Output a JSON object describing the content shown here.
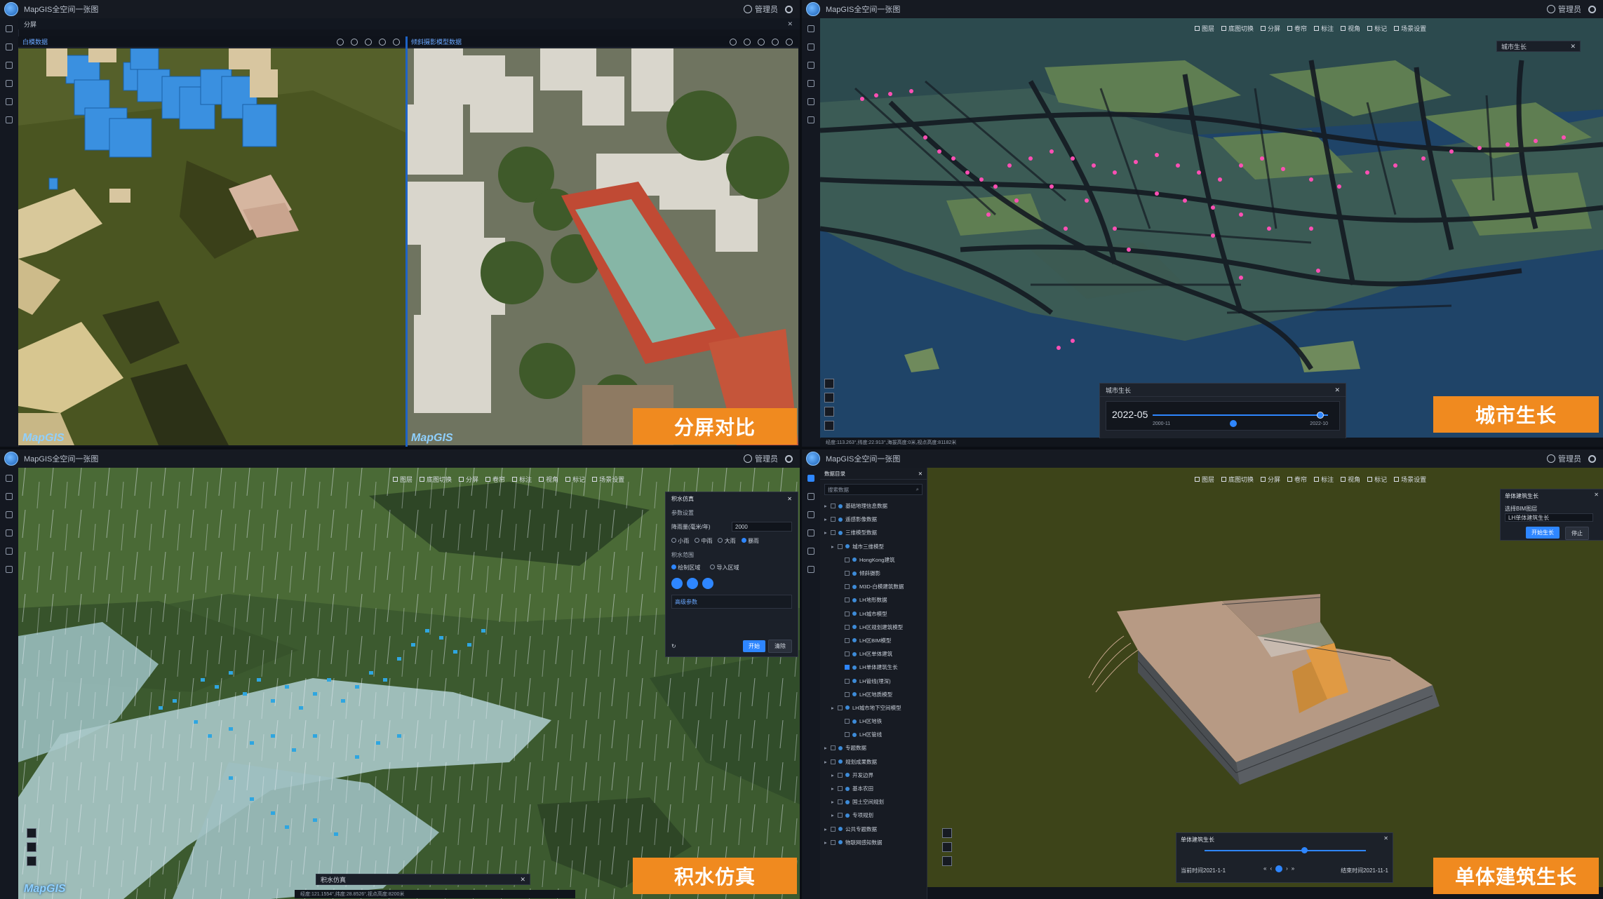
{
  "colors": {
    "accent": "#f08a1f",
    "blue": "#2e86ff",
    "pink": "#ff4fb4"
  },
  "q1": {
    "title": "MapGIS全空间一张图",
    "user": "管理员",
    "tab": "分屏",
    "left_panel_title": "白模数据",
    "right_panel_title": "倾斜摄影模型数据",
    "logo": "MapGIS",
    "tag": "分屏对比"
  },
  "q2": {
    "title": "MapGIS全空间一张图",
    "user": "管理员",
    "toolbar": [
      "图层",
      "底图切换",
      "分屏",
      "卷帘",
      "标注",
      "视角",
      "标记",
      "场景设置"
    ],
    "side_panel_title": "城市生长",
    "timeline": {
      "title": "城市生长",
      "current": "2022-05",
      "min": "2000-11",
      "max": "2022-10",
      "progress": 0.95
    },
    "status": "经度:113.263°,纬度:22.913°,海拔高度:0米,视点高度:81182米",
    "tag": "城市生长"
  },
  "q3": {
    "title": "MapGIS全空间一张图",
    "user": "管理员",
    "toolbar": [
      "图层",
      "底图切换",
      "分屏",
      "卷帘",
      "标注",
      "视角",
      "标记",
      "场景设置"
    ],
    "panel": {
      "title": "积水仿真",
      "section1": "参数设置",
      "param_label": "降雨量(毫米/年)",
      "param_value": "2000",
      "levels": [
        "小雨",
        "中雨",
        "大雨",
        "暴雨"
      ],
      "section2": "积水范围",
      "mode_options": [
        "绘制区域",
        "导入区域"
      ],
      "expand": "高级参数",
      "start": "开始",
      "clear": "清除"
    },
    "bottom_panel": "积水仿真",
    "status": "经度:121.1554°,纬度:28.8526°,视点高度:8200米",
    "logo": "MapGIS",
    "tag": "积水仿真"
  },
  "q4": {
    "title": "MapGIS全空间一张图",
    "user": "管理员",
    "tree_title": "数据目录",
    "tree_search": "搜索数据",
    "tree": [
      {
        "label": "基础地理信息数据",
        "level": 0,
        "checked": false
      },
      {
        "label": "遥感影像数据",
        "level": 0,
        "checked": false
      },
      {
        "label": "三维模型数据",
        "level": 0,
        "checked": false
      },
      {
        "label": "城市三维模型",
        "level": 1,
        "checked": false
      },
      {
        "label": "HongKong建筑",
        "level": 2,
        "checked": false
      },
      {
        "label": "倾斜摄影",
        "level": 2,
        "checked": false
      },
      {
        "label": "M3D-白模建筑数据",
        "level": 2,
        "checked": false
      },
      {
        "label": "LH地形数据",
        "level": 2,
        "checked": false
      },
      {
        "label": "LH城市模型",
        "level": 2,
        "checked": false
      },
      {
        "label": "LH区规划建筑模型",
        "level": 2,
        "checked": false
      },
      {
        "label": "LH区BIM模型",
        "level": 2,
        "checked": false
      },
      {
        "label": "LH区单体建筑",
        "level": 2,
        "checked": false
      },
      {
        "label": "LH单体建筑生长",
        "level": 2,
        "checked": true
      },
      {
        "label": "LH管线(埋深)",
        "level": 2,
        "checked": false
      },
      {
        "label": "LH区地质模型",
        "level": 2,
        "checked": false
      },
      {
        "label": "LH城市地下空间模型",
        "level": 1,
        "checked": false
      },
      {
        "label": "LH区地铁",
        "level": 2,
        "checked": false
      },
      {
        "label": "LH区管线",
        "level": 2,
        "checked": false
      },
      {
        "label": "专题数据",
        "level": 0,
        "checked": false
      },
      {
        "label": "规划成果数据",
        "level": 0,
        "checked": false
      },
      {
        "label": "开发边界",
        "level": 1,
        "checked": false
      },
      {
        "label": "基本农田",
        "level": 1,
        "checked": false
      },
      {
        "label": "国土空间规划",
        "level": 1,
        "checked": false
      },
      {
        "label": "专项规划",
        "level": 1,
        "checked": false
      },
      {
        "label": "公共专题数据",
        "level": 0,
        "checked": false
      },
      {
        "label": "物联网感知数据",
        "level": 0,
        "checked": false
      }
    ],
    "toolbar": [
      "图层",
      "底图切换",
      "分屏",
      "卷帘",
      "标注",
      "视角",
      "标记",
      "场景设置"
    ],
    "growth_panel": {
      "title": "单体建筑生长",
      "label": "选择BIM图层",
      "select": "LH单体建筑生长",
      "start": "开始生长",
      "stop": "停止"
    },
    "growth_timeline": {
      "title": "单体建筑生长",
      "start": "当前时间2021-1-1",
      "end": "结束时间2021-11-1"
    },
    "tag": "单体建筑生长"
  }
}
